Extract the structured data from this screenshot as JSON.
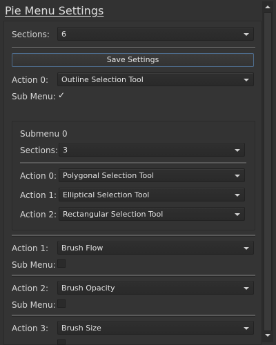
{
  "title": "Pie Menu Settings",
  "sections": {
    "label": "Sections:",
    "value": "6"
  },
  "save_button": "Save Settings",
  "actions": [
    {
      "label": "Action 0:",
      "value": "Outline Selection Tool",
      "sub_label": "Sub Menu:",
      "sub_checked": true,
      "check_glyph": "✓"
    },
    {
      "label": "Action 1:",
      "value": "Brush Flow",
      "sub_label": "Sub Menu:",
      "sub_checked": false
    },
    {
      "label": "Action 2:",
      "value": "Brush Opacity",
      "sub_label": "Sub Menu:",
      "sub_checked": false
    },
    {
      "label": "Action 3:",
      "value": "Brush Size"
    }
  ],
  "submenu": {
    "title": "Submenu 0",
    "sections": {
      "label": "Sections:",
      "value": "3"
    },
    "actions": [
      {
        "label": "Action 0:",
        "value": "Polygonal Selection Tool"
      },
      {
        "label": "Action 1:",
        "value": "Elliptical Selection Tool"
      },
      {
        "label": "Action 2:",
        "value": "Rectangular Selection Tool"
      }
    ]
  },
  "icons": [
    "chevron-down-icon",
    "checkmark-icon",
    "scroll-up-icon",
    "scroll-down-icon"
  ]
}
